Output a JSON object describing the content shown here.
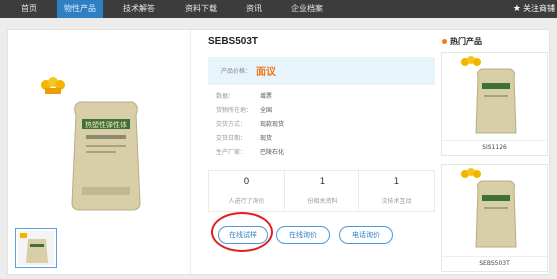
{
  "nav": {
    "items": [
      "首页",
      "物性产品",
      "技术解答",
      "资料下载",
      "资讯",
      "企业档案"
    ],
    "active_index": 1,
    "follow_label": "关注商铺"
  },
  "product": {
    "title": "SEBS503T",
    "price_label": "产品价格：",
    "price_value": "面议",
    "attrs": [
      {
        "key": "数据：",
        "value": "增票"
      },
      {
        "key": "货物所在地：",
        "value": "全国"
      },
      {
        "key": "交货方式：",
        "value": "现款现货"
      },
      {
        "key": "交货日期：",
        "value": "现货"
      },
      {
        "key": "生产厂家：",
        "value": "巴陵石化"
      }
    ],
    "stats": [
      {
        "value": "0",
        "label": "人进行了询价"
      },
      {
        "value": "1",
        "label": "份相关资料"
      },
      {
        "value": "1",
        "label": "次技术互动"
      }
    ],
    "buttons": {
      "trial": "在线试样",
      "inquiry": "在线询价",
      "phone": "电话询价"
    },
    "bag_text": "热塑性弹性体"
  },
  "hot": {
    "title": "热门产品",
    "items": [
      {
        "name": "SIS1126"
      },
      {
        "name": "SEBS503T"
      }
    ]
  },
  "colors": {
    "accent": "#2f7fc4",
    "price": "#f07a1a",
    "highlight_circle": "#e02020"
  }
}
